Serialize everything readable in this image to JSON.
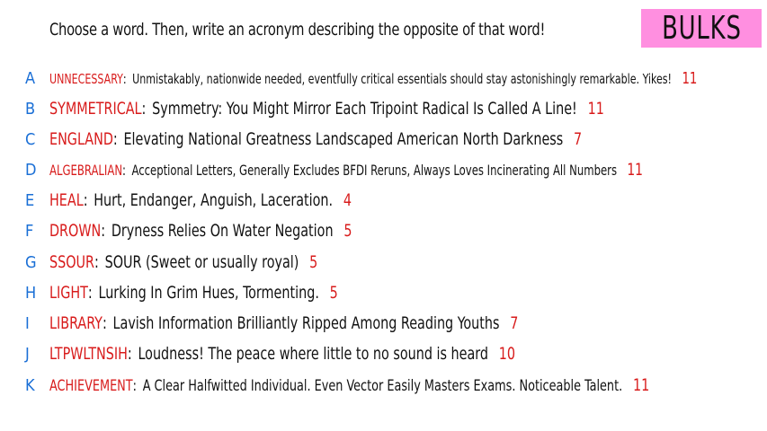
{
  "prompt": "Choose a word. Then, write an acronym describing the opposite of that word!",
  "badge": "BULKS",
  "colors": {
    "letter": "#1a6fd6",
    "word": "#d81b1b",
    "score": "#d81b1b",
    "badge_bg": "#ff8fe0"
  },
  "entries": [
    {
      "letter": "A",
      "word": "UNNECESSARY",
      "definition": "Unmistakably, nationwide needed, eventfully critical essentials should stay astonishingly remarkable. Yikes!",
      "score": "11"
    },
    {
      "letter": "B",
      "word": "SYMMETRICAL",
      "definition": "Symmetry: You Might Mirror Each Tripoint Radical Is Called A Line!",
      "score": "11"
    },
    {
      "letter": "C",
      "word": "ENGLAND",
      "definition": "Elevating National Greatness Landscaped American North Darkness",
      "score": "7"
    },
    {
      "letter": "D",
      "word": "ALGEBRALIAN",
      "definition": "Acceptional Letters, Generally Excludes BFDI Reruns, Always Loves Incinerating All Numbers",
      "score": "11"
    },
    {
      "letter": "E",
      "word": "HEAL",
      "definition": "Hurt, Endanger, Anguish, Laceration.",
      "score": "4"
    },
    {
      "letter": "F",
      "word": "DROWN",
      "definition": "Dryness Relies On Water Negation",
      "score": "5"
    },
    {
      "letter": "G",
      "word": "SSOUR",
      "definition": "SOUR (Sweet or usually royal)",
      "score": "5"
    },
    {
      "letter": "H",
      "word": "LIGHT",
      "definition": "Lurking In Grim Hues, Tormenting.",
      "score": "5"
    },
    {
      "letter": "I",
      "word": "LIBRARY",
      "definition": "Lavish Information Brilliantly Ripped Among Reading Youths",
      "score": "7"
    },
    {
      "letter": "J",
      "word": "LTPWLTNSIH",
      "definition": "Loudness! The peace where little to no sound is heard",
      "score": "10"
    },
    {
      "letter": "K",
      "word": "ACHIEVEMENT",
      "definition": "A Clear Halfwitted Individual. Even Vector Easily Masters Exams. Noticeable Talent.",
      "score": "11"
    }
  ]
}
